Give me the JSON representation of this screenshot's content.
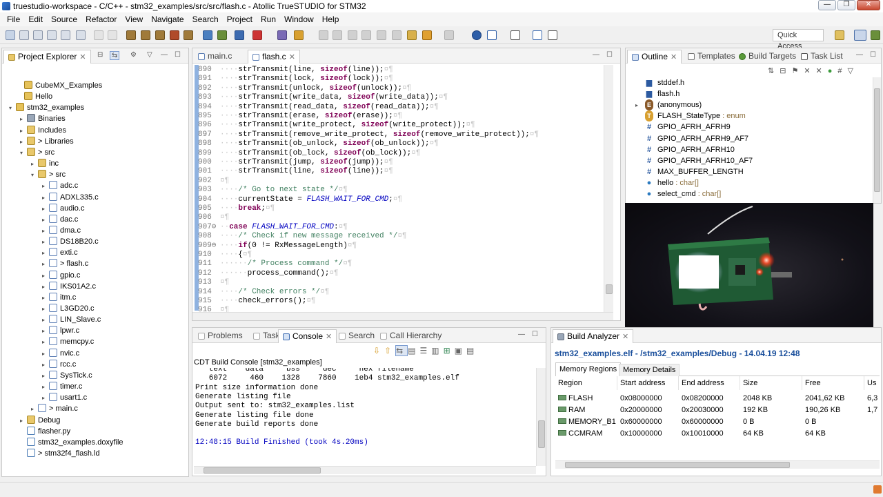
{
  "window": {
    "title": "truestudio-workspace - C/C++ - stm32_examples/src/src/flash.c - Atollic TrueSTUDIO for STM32",
    "min_label": "—",
    "max_label": "❐",
    "close_label": "✕"
  },
  "menu": [
    "File",
    "Edit",
    "Source",
    "Refactor",
    "View",
    "Navigate",
    "Search",
    "Project",
    "Run",
    "Window",
    "Help"
  ],
  "toolbar": {
    "quick_access": "Quick Access"
  },
  "project_explorer": {
    "tab_label": "Project Explorer",
    "items": [
      {
        "label": "CubeMX_Examples"
      },
      {
        "label": "Hello"
      },
      {
        "label": "stm32_examples"
      },
      {
        "label": "Binaries"
      },
      {
        "label": "Includes"
      },
      {
        "label": "> Libraries"
      },
      {
        "label": "> src"
      },
      {
        "label": "inc"
      },
      {
        "label": "> src"
      },
      {
        "label": "adc.c"
      },
      {
        "label": "ADXL335.c"
      },
      {
        "label": "audio.c"
      },
      {
        "label": "dac.c"
      },
      {
        "label": "dma.c"
      },
      {
        "label": "DS18B20.c"
      },
      {
        "label": "exti.c"
      },
      {
        "label": "> flash.c"
      },
      {
        "label": "gpio.c"
      },
      {
        "label": "IKS01A2.c"
      },
      {
        "label": "itm.c"
      },
      {
        "label": "L3GD20.c"
      },
      {
        "label": "LIN_Slave.c"
      },
      {
        "label": "lpwr.c"
      },
      {
        "label": "memcpy.c"
      },
      {
        "label": "nvic.c"
      },
      {
        "label": "rcc.c"
      },
      {
        "label": "SysTick.c"
      },
      {
        "label": "timer.c"
      },
      {
        "label": "usart1.c"
      },
      {
        "label": "> main.c"
      },
      {
        "label": "Debug"
      },
      {
        "label": "flasher.py"
      },
      {
        "label": "stm32_examples.doxyfile"
      },
      {
        "label": "> stm32f4_flash.ld"
      }
    ]
  },
  "editor": {
    "tabs": [
      "main.c",
      "flash.c"
    ],
    "lines": [
      {
        "n": "890",
        "code": "strTransmit(line, sizeof(line));"
      },
      {
        "n": "891",
        "code": "strTransmit(lock, sizeof(lock));"
      },
      {
        "n": "892",
        "code": "strTransmit(unlock, sizeof(unlock));"
      },
      {
        "n": "893",
        "code": "strTransmit(write_data, sizeof(write_data));"
      },
      {
        "n": "894",
        "code": "strTransmit(read_data, sizeof(read_data));"
      },
      {
        "n": "895",
        "code": "strTransmit(erase, sizeof(erase));"
      },
      {
        "n": "896",
        "code": "strTransmit(write_protect, sizeof(write_protect));"
      },
      {
        "n": "897",
        "code": "strTransmit(remove_write_protect, sizeof(remove_write_protect));"
      },
      {
        "n": "898",
        "code": "strTransmit(ob_unlock, sizeof(ob_unlock));"
      },
      {
        "n": "899",
        "code": "strTransmit(ob_lock, sizeof(ob_lock));"
      },
      {
        "n": "900",
        "code": "strTransmit(jump, sizeof(jump));"
      },
      {
        "n": "901",
        "code": "strTransmit(line, sizeof(line));"
      },
      {
        "n": "902",
        "code": ""
      },
      {
        "n": "903",
        "code": "/* Go to next state */"
      },
      {
        "n": "904",
        "code": "currentState = FLASH_WAIT_FOR_CMD;"
      },
      {
        "n": "905",
        "code": "break;"
      },
      {
        "n": "906",
        "code": ""
      },
      {
        "n": "907⊖",
        "code": "case FLASH_WAIT_FOR_CMD:"
      },
      {
        "n": "908",
        "code": "/* Check if new message received */"
      },
      {
        "n": "909⊖",
        "code": "if(0 != RxMessageLength)"
      },
      {
        "n": "910",
        "code": "{"
      },
      {
        "n": "911",
        "code": "/* Process command */"
      },
      {
        "n": "912",
        "code": "process_command();"
      },
      {
        "n": "913",
        "code": ""
      },
      {
        "n": "914",
        "code": "/* Check errors */"
      },
      {
        "n": "915",
        "code": "check_errors();"
      },
      {
        "n": "916",
        "code": ""
      }
    ]
  },
  "console": {
    "tabs": [
      "Problems",
      "Tasks",
      "Console",
      "Search",
      "Call Hierarchy"
    ],
    "header": "CDT Build Console [stm32_examples]",
    "lines": [
      "   text    data     bss     dec     hex filename",
      "   6072     460    1328    7860    1eb4 stm32_examples.elf",
      "Print size information done",
      "Generate listing file",
      "Output sent to: stm32_examples.list",
      "Generate listing file done",
      "Generate build reports done",
      "",
      "12:48:15 Build Finished (took 4s.20ms)"
    ]
  },
  "outline": {
    "tabs": [
      "Outline",
      "Templates",
      "Build Targets",
      "Task List"
    ],
    "items": [
      {
        "icon": "include",
        "label": "stddef.h",
        "type": ""
      },
      {
        "icon": "include",
        "label": "flash.h",
        "type": ""
      },
      {
        "icon": "enum",
        "label": "(anonymous)",
        "type": ""
      },
      {
        "icon": "typedef",
        "label": "FLASH_StateType",
        "type": " : enum"
      },
      {
        "icon": "macro",
        "label": "GPIO_AFRH_AFRH9",
        "type": ""
      },
      {
        "icon": "macro",
        "label": "GPIO_AFRH_AFRH9_AF7",
        "type": ""
      },
      {
        "icon": "macro",
        "label": "GPIO_AFRH_AFRH10",
        "type": ""
      },
      {
        "icon": "macro",
        "label": "GPIO_AFRH_AFRH10_AF7",
        "type": ""
      },
      {
        "icon": "macro",
        "label": "MAX_BUFFER_LENGTH",
        "type": ""
      },
      {
        "icon": "static-var",
        "label": "hello",
        "type": " : char[]"
      },
      {
        "icon": "static-var",
        "label": "select_cmd",
        "type": " : char[]"
      }
    ]
  },
  "build_analyzer": {
    "tab_label": "Build Analyzer",
    "path_title": "stm32_examples.elf - /stm32_examples/Debug - 14.04.19 12:48",
    "subtabs": [
      "Memory Regions",
      "Memory Details"
    ],
    "columns": [
      "Region",
      "Start address",
      "End address",
      "Size",
      "Free",
      "Us"
    ],
    "rows": [
      {
        "region": "FLASH",
        "start": "0x08000000",
        "end": "0x08200000",
        "size": "2048 KB",
        "free": "2041,62 KB",
        "used": "6,3"
      },
      {
        "region": "RAM",
        "start": "0x20000000",
        "end": "0x20030000",
        "size": "192 KB",
        "free": "190,26 KB",
        "used": "1,7"
      },
      {
        "region": "MEMORY_B1",
        "start": "0x60000000",
        "end": "0x60000000",
        "size": "0 B",
        "free": "0 B",
        "used": ""
      },
      {
        "region": "CCMRAM",
        "start": "0x10000000",
        "end": "0x10010000",
        "size": "64 KB",
        "free": "64 KB",
        "used": ""
      }
    ]
  },
  "colors": {
    "accent_blue": "#1a4f9c",
    "keyword": "#7f0055",
    "comment": "#3f7f5f",
    "constant": "#0000c0",
    "console_blue": "#0000c0"
  }
}
